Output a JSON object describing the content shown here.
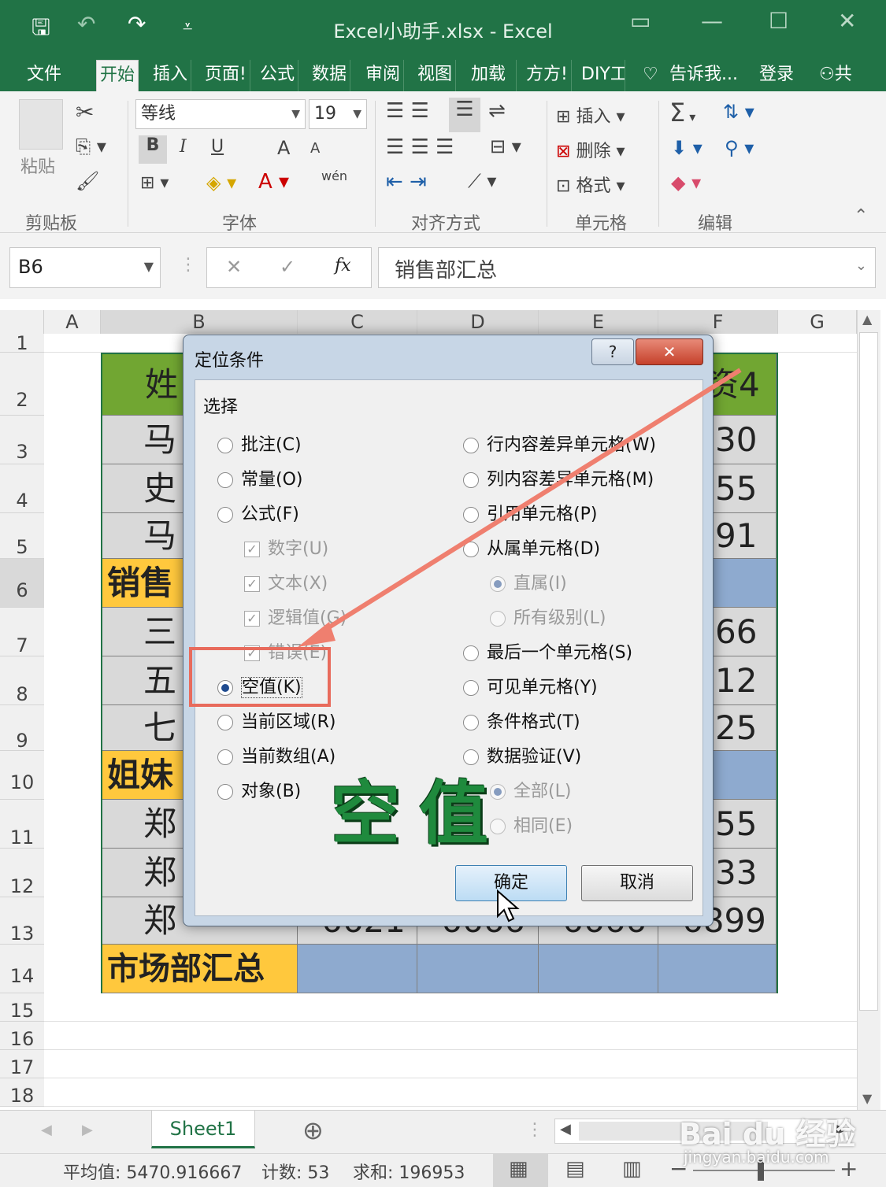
{
  "window": {
    "title": "Excel小助手.xlsx - Excel"
  },
  "tabs": [
    "文件",
    "开始",
    "插入",
    "页面!",
    "公式",
    "数据",
    "审阅",
    "视图",
    "加载",
    "方方!",
    "DIY工",
    "告诉我...",
    "登录",
    "共"
  ],
  "ribbon": {
    "clipboard": {
      "paste": "粘贴",
      "label": "剪贴板"
    },
    "font": {
      "name": "等线",
      "size": "19",
      "label": "字体",
      "bold": "B",
      "italic": "I",
      "underline": "U",
      "grow": "A",
      "shrink": "A",
      "phonetic": "wén"
    },
    "alignment": {
      "label": "对齐方式"
    },
    "cells": {
      "insert": "插入",
      "delete": "删除",
      "format": "格式",
      "label": "单元格"
    },
    "editing": {
      "label": "编辑",
      "sum": "Σ"
    }
  },
  "formula_bar": {
    "name_box": "B6",
    "cancel": "✕",
    "enter": "✓",
    "fx": "fx",
    "content": "销售部汇总"
  },
  "columns": [
    "A",
    "B",
    "C",
    "D",
    "E",
    "F",
    "G"
  ],
  "rows": [
    "1",
    "2",
    "3",
    "4",
    "5",
    "6",
    "7",
    "8",
    "9",
    "10",
    "11",
    "12",
    "13",
    "14",
    "15",
    "16",
    "17",
    "18"
  ],
  "cells": {
    "r2b": "姓",
    "r2f": "资4",
    "r3b": "马",
    "r3f": "30",
    "r4b": "史",
    "r4f": "55",
    "r5b": "马",
    "r5f": "91",
    "r6b": "销售",
    "r7b": "三",
    "r7f": "66",
    "r8b": "五",
    "r8f": "12",
    "r9b": "七",
    "r9f": "25",
    "r10b": "姐妹",
    "r11b": "郑",
    "r11f": "55",
    "r12b": "郑",
    "r12f": "33",
    "r13b": "郑",
    "r13c": "6621",
    "r13d": "6666",
    "r13e": "6666",
    "r13f": "6899",
    "r14b": "市场部汇总"
  },
  "dialog": {
    "title": "定位条件",
    "help": "?",
    "close": "✕",
    "section": "选择",
    "left_options": [
      "批注(C)",
      "常量(O)",
      "公式(F)"
    ],
    "formula_sub": [
      "数字(U)",
      "文本(X)",
      "逻辑值(G)",
      "错误(E)"
    ],
    "left_options2": [
      "空值(K)",
      "当前区域(R)",
      "当前数组(A)",
      "对象(B)"
    ],
    "right_options": [
      "行内容差异单元格(W)",
      "列内容差异单元格(M)",
      "引用单元格(P)",
      "从属单元格(D)"
    ],
    "dependents_sub": [
      "直属(I)",
      "所有级别(L)"
    ],
    "right_options2": [
      "最后一个单元格(S)",
      "可见单元格(Y)",
      "条件格式(T)",
      "数据验证(V)"
    ],
    "validation_sub": [
      "全部(L)",
      "相同(E)"
    ],
    "ok": "确定",
    "cancel": "取消",
    "overlay_text": "空值"
  },
  "sheet_tabs": [
    "Sheet1"
  ],
  "status": {
    "average": "平均值: 5470.916667",
    "count": "计数: 53",
    "sum": "求和: 196953"
  },
  "watermark": {
    "brand": "Bai du 经验",
    "url": "jingyan.baidu.com"
  }
}
